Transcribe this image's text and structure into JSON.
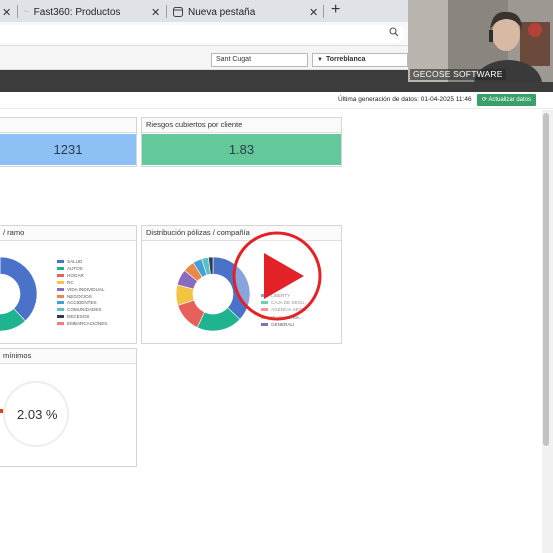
{
  "browser": {
    "tabs": [
      {
        "label": "Fast360: Productos"
      },
      {
        "label": "Nueva pestaña"
      }
    ]
  },
  "topbar": {
    "office_select": "Sant Cugat",
    "agent_select": "Torreblanca"
  },
  "subbar": {
    "generation_text": "Última generación de datos: 01-04-2025 11:46",
    "refresh_label": "Actualizar datos"
  },
  "kpis": [
    {
      "title": "",
      "value": "1231",
      "color": "#8dc0f4"
    },
    {
      "title": "Riesgos cubiertos por cliente",
      "value": "1.83",
      "color": "#63c99a"
    }
  ],
  "panels": {
    "ramo": {
      "title": "/ ramo",
      "legend": [
        "SALUD",
        "AUTOS",
        "HOGAR",
        "RC",
        "VIDA INDIVIDUAL",
        "NEGOCIOS",
        "ACCIDENTES",
        "COMUNIDADES",
        "DECESOS",
        "EMBARCACIONES"
      ]
    },
    "compania": {
      "title": "Distribución pólizas / compañía",
      "legend": [
        "LIBERTY",
        "CAJA DE SEGU...",
        "AGENCIA SEGU...",
        "PLUS ULTRA...",
        "GENERALI"
      ]
    },
    "minimos": {
      "title": "mínimos",
      "value": "2.03 %"
    }
  },
  "webcam": {
    "label": "GECOSE SOFTWARE"
  },
  "chart_data": [
    {
      "type": "pie",
      "categories": [
        "SALUD",
        "AUTOS",
        "HOGAR",
        "RC",
        "VIDA INDIVIDUAL",
        "NEGOCIOS",
        "ACCIDENTES",
        "COMUNIDADES",
        "DECESOS",
        "EMBARCACIONES"
      ],
      "values": [
        38,
        22,
        12,
        7,
        6,
        5,
        4,
        3,
        2,
        1
      ]
    },
    {
      "type": "pie",
      "values": [
        37,
        20,
        13,
        9,
        7,
        5,
        4,
        3,
        2
      ]
    }
  ],
  "colors": {
    "series": [
      "#4a72c9",
      "#1fb48f",
      "#e8605a",
      "#f3c441",
      "#8a6bbd",
      "#e8894b",
      "#43a1d8",
      "#5bc0c8",
      "#2f3c4d",
      "#f07d7d"
    ]
  }
}
